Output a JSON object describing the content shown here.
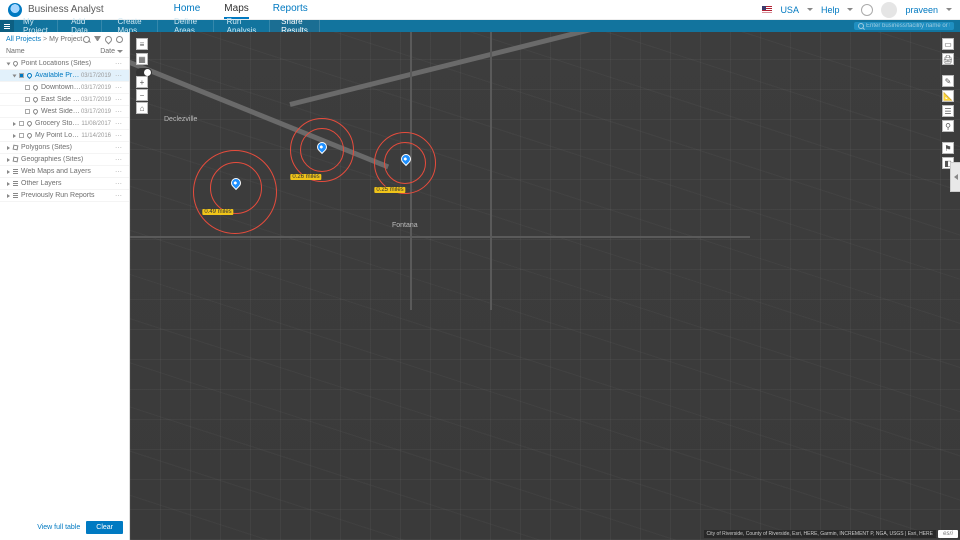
{
  "brand": "Business Analyst",
  "topnav": {
    "home": "Home",
    "maps": "Maps",
    "reports": "Reports"
  },
  "topright": {
    "country": "USA",
    "help": "Help",
    "user": "praveen"
  },
  "ribbon": {
    "myproject": "My Project",
    "adddata": "Add Data",
    "createmaps": "Create Maps",
    "defineareas": "Define Areas",
    "runanalysis": "Run Analysis",
    "share": "Share Results"
  },
  "search": {
    "placeholder": "Enter business/facility name or type"
  },
  "crumbs": {
    "root": "All Projects",
    "sep": ">",
    "current": "My Project"
  },
  "listhdr": {
    "name": "Name",
    "date": "Date"
  },
  "rows": {
    "pointlocations": {
      "label": "Point Locations (Sites)"
    },
    "avail": {
      "label": "Available Properties",
      "date": "03/17/2019"
    },
    "downtown": {
      "label": "Downtown Location",
      "date": "03/17/2019"
    },
    "east": {
      "label": "East Side Location",
      "date": "03/17/2019"
    },
    "west": {
      "label": "West Side Location",
      "date": "03/17/2019"
    },
    "grocery": {
      "label": "Grocery Stores",
      "date": "11/08/2017"
    },
    "mypoint": {
      "label": "My Point Locations",
      "date": "11/14/2016"
    },
    "polygons": {
      "label": "Polygons (Sites)"
    },
    "geos": {
      "label": "Geographies (Sites)"
    },
    "webmaps": {
      "label": "Web Maps and Layers"
    },
    "other": {
      "label": "Other Layers"
    },
    "prev": {
      "label": "Previously Run Reports"
    }
  },
  "panel": {
    "viewfull": "View full table",
    "clear": "Clear"
  },
  "map": {
    "city_fontana": "Fontana",
    "dist_a": "0.49 miles",
    "dist_b": "0.26 miles",
    "dist_c": "0.25 miles",
    "attribution": "City of Riverside, County of Riverside, Esri, HERE, Garmin, INCREMENT P, NGA, USGS | Esri, HERE",
    "esri": "esri",
    "neighborhood": "Declezville"
  },
  "tools": {
    "plus": "+",
    "minus": "−",
    "home": "⌂",
    "pan": "✥",
    "extent": "▭",
    "ruler": "📏",
    "select": "▦",
    "layers": "≋",
    "legend": "☰",
    "basemap": "▦",
    "color": "◧"
  }
}
